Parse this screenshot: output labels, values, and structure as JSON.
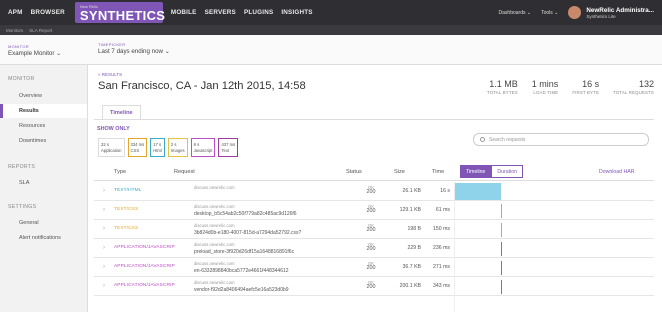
{
  "topnav": {
    "items": [
      "APM",
      "BROWSER",
      "MOBILE",
      "SERVERS",
      "PLUGINS",
      "INSIGHTS"
    ],
    "brand_small": "New Relic",
    "brand": "SYNTHETICS",
    "dashboards": "Dashboards ⌄",
    "tools": "Tools ⌄",
    "user_name": "NewRelic Administra...",
    "user_account": "Synthetics Lite"
  },
  "subnav": {
    "items": [
      "Monitors",
      "SLA Report"
    ]
  },
  "filter": {
    "monitor_label": "MONITOR",
    "monitor_value": "Example Monitor ⌄",
    "time_label": "TIMEPICKER",
    "time_value": "Last 7 days ending now ⌄"
  },
  "sidebar": {
    "monitor_head": "MONITOR",
    "reports_head": "REPORTS",
    "settings_head": "SETTINGS",
    "items": [
      "Overview",
      "Results",
      "Resources",
      "Downtimes",
      "SLA",
      "General",
      "Alert notifications"
    ]
  },
  "main": {
    "back": "« RESULTS",
    "title": "San Francisco, CA - Jan 12th 2015, 14:58",
    "stats": [
      {
        "value": "1.1 MB",
        "label": "TOTAL BYTES"
      },
      {
        "value": "1 mins",
        "label": "LOAD TIME"
      },
      {
        "value": "16 s",
        "label": "FIRST BYTE"
      },
      {
        "value": "132",
        "label": "TOTAL REQUESTS"
      }
    ],
    "tab": "Timeline",
    "show_only": "SHOW ONLY",
    "chips": [
      {
        "v": "32 s",
        "l": "Application"
      },
      {
        "v": "334 ms",
        "l": "CSS"
      },
      {
        "v": "17 s",
        "l": "Html"
      },
      {
        "v": "2 s",
        "l": "Images"
      },
      {
        "v": "6 s",
        "l": "Javascript"
      },
      {
        "v": "437 ms",
        "l": "Text"
      }
    ],
    "search_placeholder": "Search requests",
    "columns": {
      "type": "Type",
      "request": "Request",
      "status": "Status",
      "size": "Size",
      "time": "Time"
    },
    "timeline_btn": "Timeline",
    "duration_btn": "Duration",
    "download": "Download HAR",
    "rows": [
      {
        "type": "TEXT/HTML",
        "domain": "discuss.newrelic.com",
        "path": "",
        "status_word": "OK",
        "status": "200",
        "size": "26.1 KB",
        "time": "16 s"
      },
      {
        "type": "TEXT/CSS",
        "domain": "discuss.newrelic.com",
        "path": "desktop_b5c54ab2c50f779a82c485ac9d126f6",
        "status_word": "OK",
        "status": "200",
        "size": "129.1 KB",
        "time": "61 ms"
      },
      {
        "type": "TEXT/CSS",
        "domain": "discuss.newrelic.com",
        "path": "3b824d0b-e180-4007-815d-a7294da52792.css?",
        "status_word": "OK",
        "status": "200",
        "size": "198 B",
        "time": "150 ms"
      },
      {
        "type": "APPLICATION/JAVASCRIP",
        "domain": "discuss.newrelic.com",
        "path": "preload_store-3f920d26df15a1648816891f6c",
        "status_word": "OK",
        "status": "200",
        "size": "229 B",
        "time": "236 ms"
      },
      {
        "type": "APPLICATION/JAVASCRIP",
        "domain": "discuss.newrelic.com",
        "path": "en-6332898840bca5772e4661f448344612",
        "status_word": "OK",
        "status": "200",
        "size": "36.7 KB",
        "time": "271 ms"
      },
      {
        "type": "APPLICATION/JAVASCRIP",
        "domain": "discuss.newrelic.com",
        "path": "vendor-f92d2a8406494aefc5e16a523d0b9",
        "status_word": "OK",
        "status": "200",
        "size": "200.1 KB",
        "time": "343 ms"
      }
    ]
  },
  "colors": {
    "accent": "#7f56b5",
    "html": "#3aa9c8",
    "css": "#e5a52a",
    "js": "#b84fc4",
    "timeline_html_bar": "#8fd3ea"
  }
}
